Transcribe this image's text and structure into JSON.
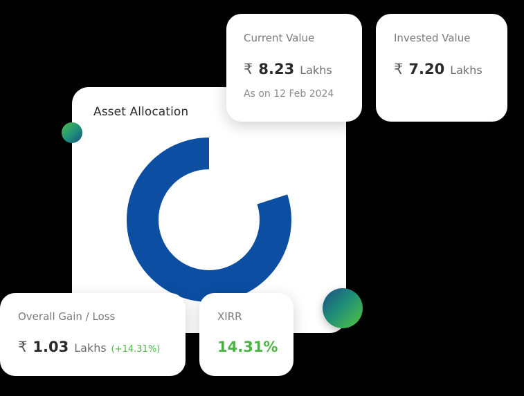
{
  "currency_symbol": "₹",
  "asset_allocation": {
    "title": "Asset Allocation",
    "donut": {
      "primary_color": "#0b4ea2",
      "secondary_color": "#ffffff",
      "primary_fraction": 0.8
    }
  },
  "current_value": {
    "label": "Current Value",
    "amount": "8.23",
    "unit": "Lakhs",
    "as_on": "As on 12 Feb 2024"
  },
  "invested_value": {
    "label": "Invested Value",
    "amount": "7.20",
    "unit": "Lakhs"
  },
  "overall_gain": {
    "label": "Overall Gain / Loss",
    "amount": "1.03",
    "unit": "Lakhs",
    "percent": "(+14.31%)"
  },
  "xirr": {
    "label": "XIRR",
    "value": "14.31%"
  },
  "colors": {
    "gain_green": "#4bb543",
    "brand_blue": "#0b4ea2"
  }
}
